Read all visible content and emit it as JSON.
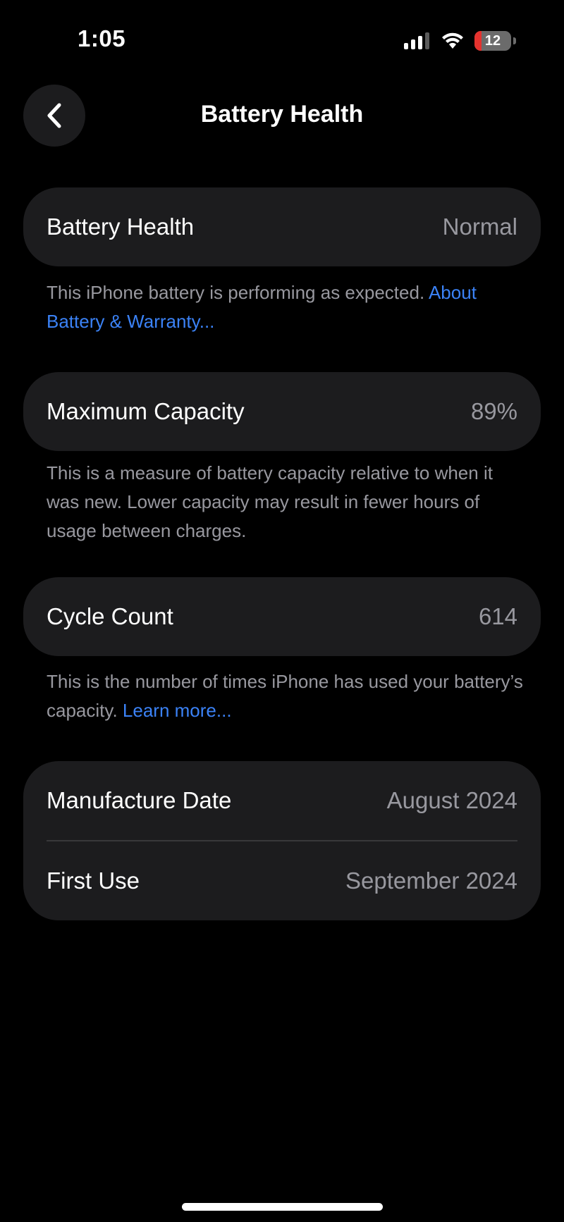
{
  "status_bar": {
    "time": "1:05",
    "battery_level": "12",
    "battery_color": "#e5322e",
    "icons": [
      "cellular-signal-icon",
      "wifi-icon",
      "battery-icon"
    ]
  },
  "nav": {
    "back_icon": "chevron-left-icon",
    "title": "Battery Health"
  },
  "battery_health": {
    "label": "Battery Health",
    "value": "Normal",
    "footnote": "This iPhone battery is performing as expected.",
    "link": "About Battery & Warranty..."
  },
  "maximum_capacity": {
    "label": "Maximum Capacity",
    "value": "89%",
    "footnote": "This is a measure of battery capacity relative to when it was new. Lower capacity may result in fewer hours of usage between charges."
  },
  "cycle_count": {
    "label": "Cycle Count",
    "value": "614",
    "footnote": "This is the number of times iPhone has used your battery’s capacity.",
    "link": "Learn more..."
  },
  "dates": {
    "manufacture_label": "Manufacture Date",
    "manufacture_value": "August 2024",
    "first_use_label": "First Use",
    "first_use_value": "September 2024"
  },
  "colors": {
    "background": "#000000",
    "card": "#1c1c1e",
    "secondary_text": "#98989f",
    "link": "#3b82f6"
  }
}
